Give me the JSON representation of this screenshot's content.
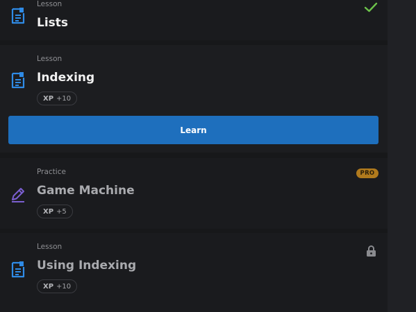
{
  "items": [
    {
      "type_label": "Lesson",
      "title": "Lists",
      "status_icon": "check-icon",
      "icon": "lesson-document-icon"
    },
    {
      "type_label": "Lesson",
      "title": "Indexing",
      "xp_label": "XP",
      "xp_value": "+10",
      "icon": "lesson-document-icon",
      "button_label": "Learn"
    },
    {
      "type_label": "Practice",
      "title": "Game Machine",
      "xp_label": "XP",
      "xp_value": "+5",
      "badge": "PRO",
      "icon": "pencil-practice-icon"
    },
    {
      "type_label": "Lesson",
      "title": "Using Indexing",
      "xp_label": "XP",
      "xp_value": "+10",
      "status_icon": "lock-icon",
      "icon": "lesson-document-icon"
    }
  ],
  "colors": {
    "accent_blue": "#1e6fbd",
    "icon_blue": "#2f8be6",
    "practice_purple": "#7b5fd0",
    "check_green": "#6cc24a",
    "pro_gold": "#b07a1d"
  }
}
